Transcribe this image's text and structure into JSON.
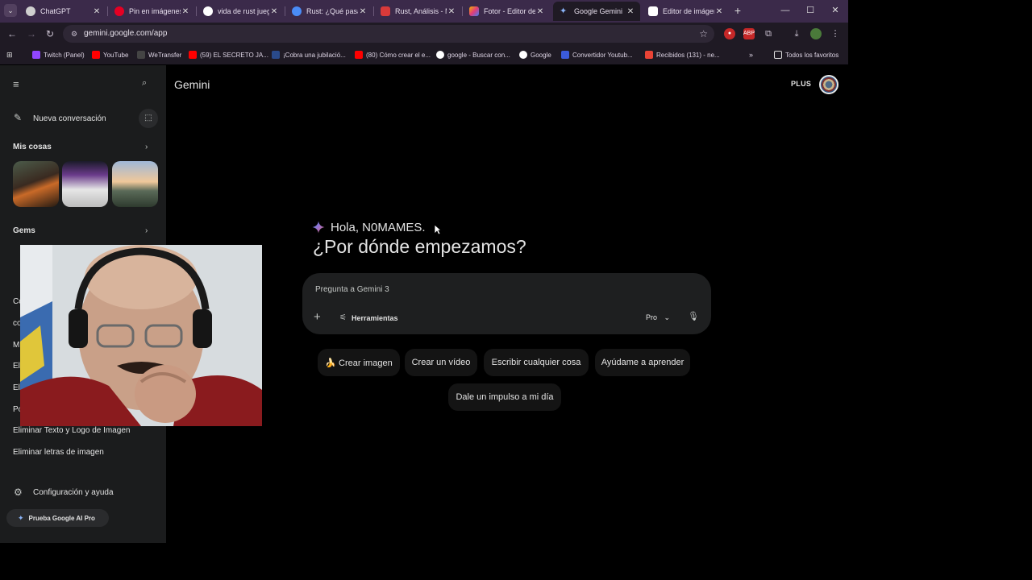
{
  "tabs": [
    {
      "title": "ChatGPT",
      "favicon_color": "#cfcfcf"
    },
    {
      "title": "Pin en imágenes",
      "favicon_color": "#e60023"
    },
    {
      "title": "vida de rust juego",
      "favicon_color": "#ffffff"
    },
    {
      "title": "Rust: ¿Qué pasa si",
      "favicon_color": "#4a8cf7"
    },
    {
      "title": "Rust, Análisis - M",
      "favicon_color": "#d93a3a"
    },
    {
      "title": "Fotor - Editor de",
      "favicon_color": "#f0b400"
    },
    {
      "title": "Google Gemini",
      "favicon_color": "#8ab4f8",
      "active": true
    },
    {
      "title": "Editor de imágen",
      "favicon_color": "#ffffff"
    }
  ],
  "address_bar": {
    "url": "gemini.google.com/app"
  },
  "bookmarks": [
    {
      "label": "Twitch (Panel)",
      "color": "#9146ff"
    },
    {
      "label": "YouTube",
      "color": "#ff0000"
    },
    {
      "label": "WeTransfer",
      "color": "#444444"
    },
    {
      "label": "(59) EL SECRETO JA...",
      "color": "#ff0000"
    },
    {
      "label": "¡Cobra una jubilació...",
      "color": "#2a4a8a"
    },
    {
      "label": "(80) Cómo crear el e...",
      "color": "#ff0000"
    },
    {
      "label": "google - Buscar con...",
      "color": "#ffffff"
    },
    {
      "label": "Google",
      "color": "#ffffff"
    },
    {
      "label": "Convertidor Youtub...",
      "color": "#3b5bdb"
    },
    {
      "label": "Recibidos (131) - ne...",
      "color": "#ea4335"
    },
    {
      "label": "Todos los favoritos",
      "color": "#1f1a24"
    }
  ],
  "sidebar": {
    "new_chat": "Nueva conversación",
    "my_stuff": "Mis cosas",
    "gems": "Gems",
    "recent": [
      "Eliminar Texto y Logo de Imagen",
      "Eliminar letras de imagen"
    ],
    "partial_letters": [
      "Co",
      "co",
      "M",
      "El",
      "El",
      "Po"
    ],
    "settings": "Configuración y ayuda",
    "promo": "Prueba Google AI Pro"
  },
  "header": {
    "brand": "Gemini",
    "plan": "PLUS"
  },
  "main": {
    "greeting": "Hola, N0MAMES.",
    "headline": "¿Por dónde empezamos?",
    "prompt_placeholder": "Pregunta a Gemini 3",
    "tools_label": "Herramientas",
    "mode_label": "Pro",
    "chips": [
      {
        "label": "🍌 Crear imagen"
      },
      {
        "label": "Crear un vídeo"
      },
      {
        "label": "Escribir cualquier cosa"
      },
      {
        "label": "Ayúdame a aprender"
      },
      {
        "label": "Dale un impulso a mi día"
      }
    ]
  },
  "icons": {
    "menu": "hamburger-icon",
    "search": "search-icon",
    "new_chat": "edit-icon",
    "temporary_chat": "temp-chat-icon",
    "settings": "gear-icon",
    "mic": "mic-icon",
    "add": "plus-icon",
    "tools": "sliders-icon"
  },
  "colors": {
    "sidebar_bg": "#1b1c1d",
    "prompt_bg": "#1e1f20",
    "tabstrip_bg": "#3b2a4a"
  }
}
